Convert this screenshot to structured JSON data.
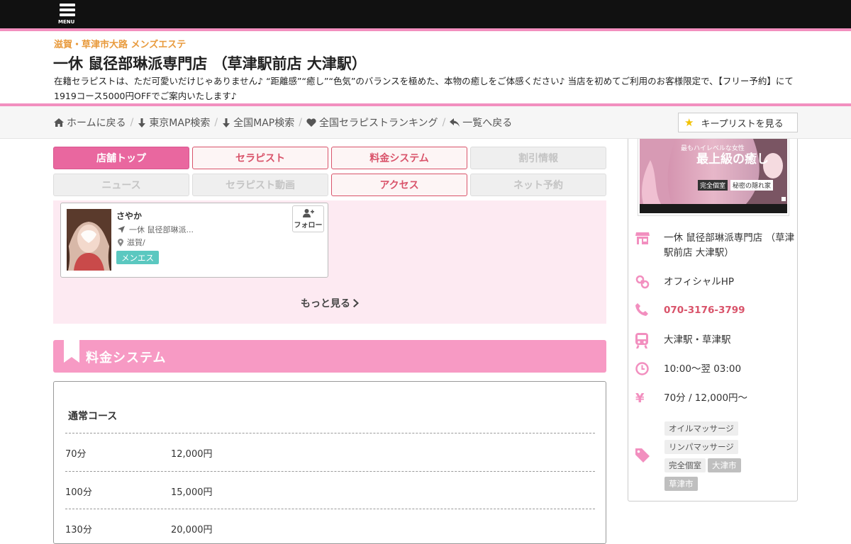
{
  "topbar": {
    "menu_label": "MENU"
  },
  "header": {
    "area": "滋賀・草津市大路 メンズエステ",
    "title": "一休 鼠径部琳派専門店 （草津駅前店 大津駅）",
    "description": "在籍セラピストは、ただ可愛いだけじゃありません♪ “距離感”“癒し”“色気”のバランスを極めた、本物の癒しをご体感ください♪ 当店を初めてご利用のお客様限定で、【フリー予約】にて1919コース5000円OFFでご案内いたします♪"
  },
  "breadcrumb": {
    "items": [
      {
        "label": "ホームに戻る",
        "icon": "home-icon"
      },
      {
        "label": "東京MAP検索",
        "icon": "arrow-down-icon"
      },
      {
        "label": "全国MAP検索",
        "icon": "arrow-down-icon"
      },
      {
        "label": "全国セラピストランキング",
        "icon": "heart-icon"
      },
      {
        "label": "一覧へ戻る",
        "icon": "reply-icon"
      }
    ],
    "separator": "/",
    "keep_list_label": "キープリストを見る"
  },
  "tabs": [
    {
      "label": "店舗トップ",
      "state": "active"
    },
    {
      "label": "セラピスト",
      "state": "on"
    },
    {
      "label": "料金システム",
      "state": "on"
    },
    {
      "label": "割引情報",
      "state": "off"
    },
    {
      "label": "ニュース",
      "state": "off"
    },
    {
      "label": "セラピスト動画",
      "state": "off"
    },
    {
      "label": "アクセス",
      "state": "on"
    },
    {
      "label": "ネット予約",
      "state": "off"
    }
  ],
  "therapist": {
    "name": "さやか",
    "shop": "一休 鼠径部琳派...",
    "area": "滋賀/",
    "badge": "メンエス",
    "follow_label": "フォロー"
  },
  "more_label": "もっと見る",
  "price_section": {
    "title": "料金システム",
    "course_title": "通常コース",
    "rows": [
      {
        "minutes": "70分",
        "price": "12,000円"
      },
      {
        "minutes": "100分",
        "price": "15,000円"
      },
      {
        "minutes": "130分",
        "price": "20,000円"
      }
    ]
  },
  "sidebar": {
    "banner": {
      "headline": "最上級の癒し",
      "sub1": "完全個室",
      "sub2": "秘密の隠れ家",
      "tagline": "最もハイレベルな女性"
    },
    "info": {
      "shop_name": "一休 鼠径部琳派専門店 （草津駅前店 大津駅）",
      "official_hp": "オフィシャルHP",
      "tel": "070-3176-3799",
      "station": "大津駅・草津駅",
      "hours": "10:00～翌 03:00",
      "price": "70分 / 12,000円～"
    },
    "tags": [
      {
        "label": "オイルマッサージ",
        "style": "light"
      },
      {
        "label": "リンパマッサージ",
        "style": "light"
      },
      {
        "label": "完全個室",
        "style": "light"
      },
      {
        "label": "大津市",
        "style": "dark"
      },
      {
        "label": "草津市",
        "style": "dark"
      }
    ]
  },
  "colors": {
    "pink": "#f28fbf",
    "accent": "#e9679f",
    "tel": "#d9536a",
    "area": "#e89a3c",
    "badge": "#5bc8c0"
  }
}
